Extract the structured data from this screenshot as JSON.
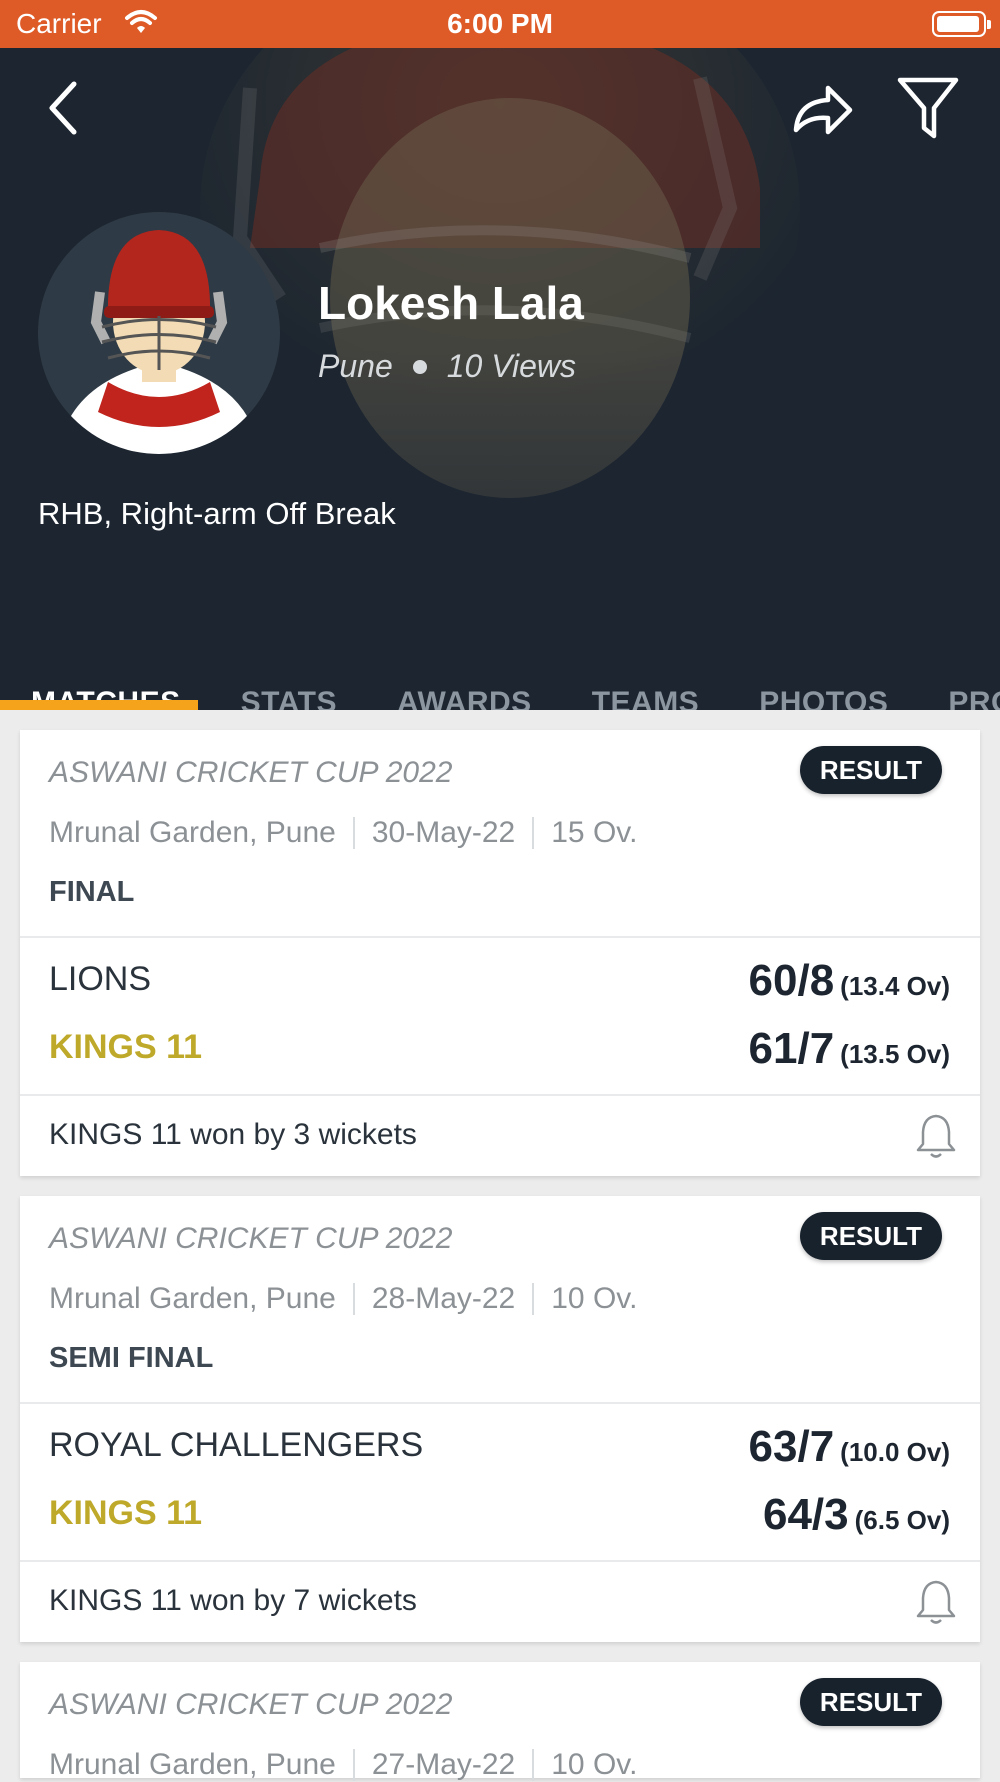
{
  "status_bar": {
    "carrier": "Carrier",
    "time": "6:00 PM"
  },
  "profile": {
    "name": "Lokesh Lala",
    "city": "Pune",
    "views": "10 Views",
    "style": "RHB, Right-arm Off Break"
  },
  "tabs": [
    {
      "label": "MATCHES",
      "active": true
    },
    {
      "label": "STATS"
    },
    {
      "label": "AWARDS"
    },
    {
      "label": "TEAMS"
    },
    {
      "label": "PHOTOS"
    },
    {
      "label": "PROFIL"
    }
  ],
  "matches": [
    {
      "tournament": "ASWANI CRICKET  CUP 2022",
      "badge": "RESULT",
      "venue": "Mrunal Garden, Pune",
      "date": "30-May-22",
      "overs": "15 Ov.",
      "round": "FINAL",
      "team1": {
        "name": "LIONS",
        "score": "60/8",
        "overs": "(13.4 Ov)"
      },
      "team2": {
        "name": "KINGS 11",
        "score": "61/7",
        "overs": "(13.5 Ov)"
      },
      "result": "KINGS 11 won by 3 wickets"
    },
    {
      "tournament": "ASWANI CRICKET  CUP 2022",
      "badge": "RESULT",
      "venue": "Mrunal Garden, Pune",
      "date": "28-May-22",
      "overs": "10 Ov.",
      "round": "SEMI FINAL",
      "team1": {
        "name": "ROYAL CHALLENGERS",
        "score": "63/7",
        "overs": "(10.0 Ov)"
      },
      "team2": {
        "name": "KINGS 11",
        "score": "64/3",
        "overs": "(6.5 Ov)"
      },
      "result": "KINGS 11 won by 7 wickets"
    },
    {
      "tournament": "ASWANI CRICKET  CUP 2022",
      "badge": "RESULT",
      "venue": "Mrunal Garden, Pune",
      "date": "27-May-22",
      "overs": "10 Ov."
    }
  ],
  "colors": {
    "status_bar": "#de5b28",
    "hero": "#1c2530",
    "tab_indicator": "#f5a31a",
    "winner": "#bfa92a"
  },
  "icons": [
    "back-icon",
    "share-icon",
    "filter-icon",
    "bell-icon",
    "wifi-icon",
    "battery-icon"
  ]
}
